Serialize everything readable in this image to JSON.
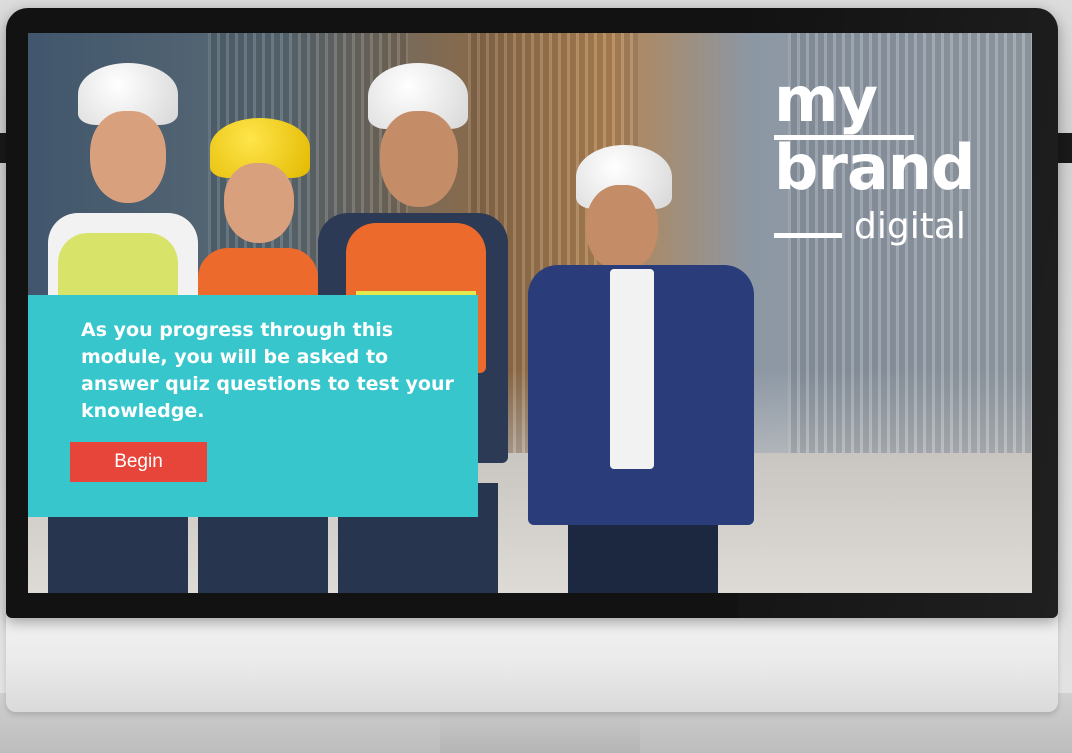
{
  "brand": {
    "line1": "my",
    "line2": "brand",
    "line3": "digital"
  },
  "intro_card": {
    "message": "As you progress through this module, you will be asked to answer quiz questions to test your knowledge.",
    "begin_label": "Begin"
  },
  "colors": {
    "card_background": "#37c6cc",
    "button_background": "#e8453a",
    "text": "#ffffff"
  }
}
